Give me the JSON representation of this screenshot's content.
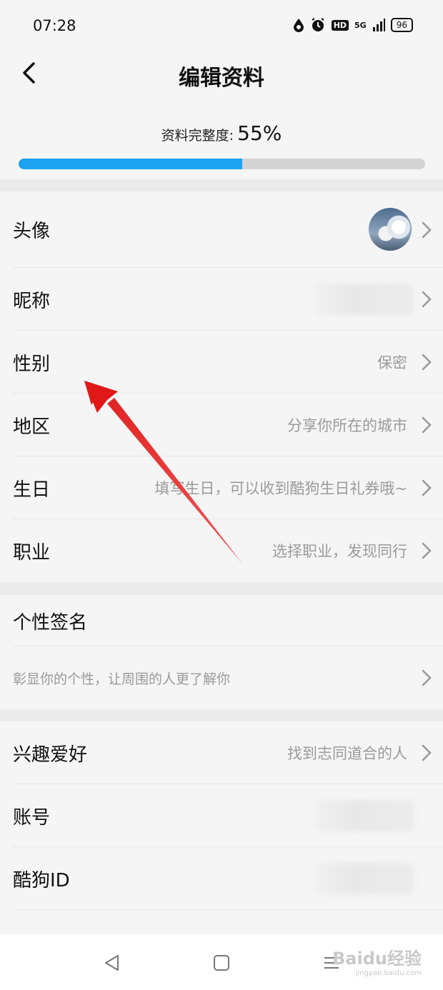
{
  "status_bar": {
    "time": "07:28",
    "hd": "HD",
    "network": "5G",
    "battery": "96"
  },
  "header": {
    "title": "编辑资料"
  },
  "completeness": {
    "label": "资料完整度:",
    "value_text": "55%",
    "fraction": 0.55,
    "fill_color": "#1ca2f0"
  },
  "rows_group1": [
    {
      "key": "avatar",
      "label": "头像",
      "value": ""
    },
    {
      "key": "nickname",
      "label": "昵称",
      "value": ""
    },
    {
      "key": "gender",
      "label": "性别",
      "value": "保密"
    },
    {
      "key": "region",
      "label": "地区",
      "value": "分享你所在的城市"
    },
    {
      "key": "birthday",
      "label": "生日",
      "value": "填写生日，可以收到酷狗生日礼券哦~"
    },
    {
      "key": "job",
      "label": "职业",
      "value": "选择职业，发现同行"
    }
  ],
  "signature": {
    "label": "个性签名",
    "placeholder": "彰显你的个性，让周围的人更了解你"
  },
  "rows_group3": [
    {
      "key": "hobby",
      "label": "兴趣爱好",
      "value": "找到志同道合的人"
    },
    {
      "key": "account",
      "label": "账号",
      "value": ""
    },
    {
      "key": "kugou_id",
      "label": "酷狗ID",
      "value": ""
    }
  ],
  "watermark": {
    "logo": "Baidu经验",
    "url": "jingyan.baidu.com"
  },
  "annotation_arrow_color": "#e01818"
}
